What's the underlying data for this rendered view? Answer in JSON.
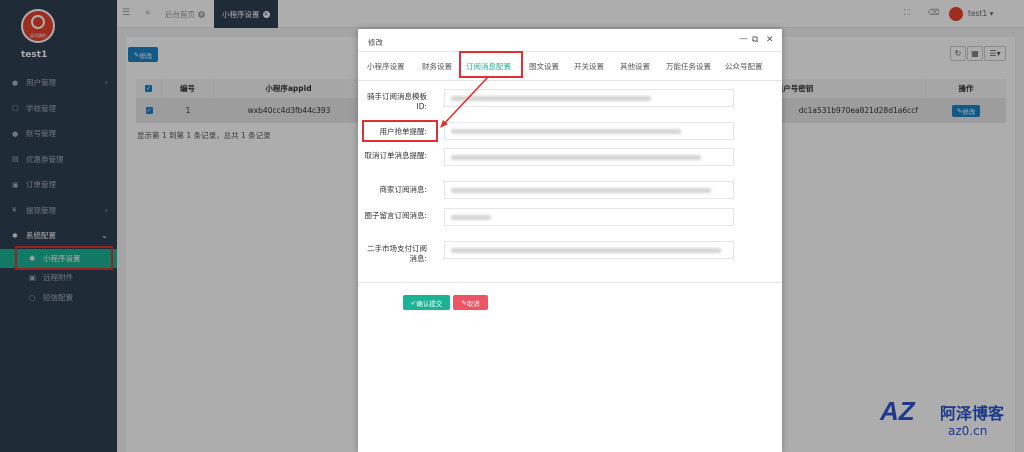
{
  "sidebar": {
    "logo_text": "英词旗帜",
    "username": "test1",
    "items": [
      {
        "label": "用户管理",
        "icon": "user-icon",
        "arrow": "‹"
      },
      {
        "label": "学校管理",
        "icon": "file-icon"
      },
      {
        "label": "账号管理",
        "icon": "users-icon"
      },
      {
        "label": "优惠券管理",
        "icon": "ticket-icon"
      },
      {
        "label": "订单管理",
        "icon": "copy-icon"
      },
      {
        "label": "提现管理",
        "icon": "yen-icon",
        "arrow": "‹"
      },
      {
        "label": "系统配置",
        "icon": "gear-icon",
        "arrow": "⌄"
      }
    ],
    "subitems": [
      {
        "label": "小程序设置",
        "icon": "gear-icon"
      },
      {
        "label": "远程附件",
        "icon": "image-icon"
      },
      {
        "label": "短信配置",
        "icon": "comment-icon"
      }
    ]
  },
  "topbar": {
    "tabs": [
      {
        "label": "后台首页"
      },
      {
        "label": "小程序设置"
      }
    ],
    "username": "test1",
    "username_caret": "▾"
  },
  "content": {
    "edit_button": "修改",
    "table": {
      "headers": [
        "编号",
        "小程序appid",
        "商户号密钥",
        "操作"
      ],
      "row": {
        "id": "1",
        "appid": "wxb40cc4d3fb44c393",
        "secret": "dc1a531b970ea821d28d1a6ccf",
        "action": "修改"
      }
    },
    "pagination": "显示第 1 到第 1 条记录，总共 1 条记录"
  },
  "modal": {
    "title": "修改",
    "tabs": [
      "小程序设置",
      "财务设置",
      "订阅消息配置",
      "图文设置",
      "开关设置",
      "其他设置",
      "万能任务设置",
      "公众号配置"
    ],
    "active_tab": 2,
    "fields": [
      {
        "label": "骑手订阅消息模板ID:"
      },
      {
        "label": "用户抢单提醒:"
      },
      {
        "label": "取消订单消息提醒:"
      },
      {
        "label": "商家订阅消息:"
      },
      {
        "label": "圈子留言订阅消息:"
      },
      {
        "label": "二手市场支付订阅消息:"
      }
    ],
    "confirm": "确认提交",
    "cancel": "取消"
  },
  "watermark": {
    "logo": "AZ",
    "name": "阿泽博客",
    "domain": "az0.cn"
  },
  "colors": {
    "sidebar": "#2f4050",
    "accent": "#1ab394",
    "primary": "#1c84c6",
    "danger": "#ed5565",
    "highlight": "#e0302f"
  }
}
